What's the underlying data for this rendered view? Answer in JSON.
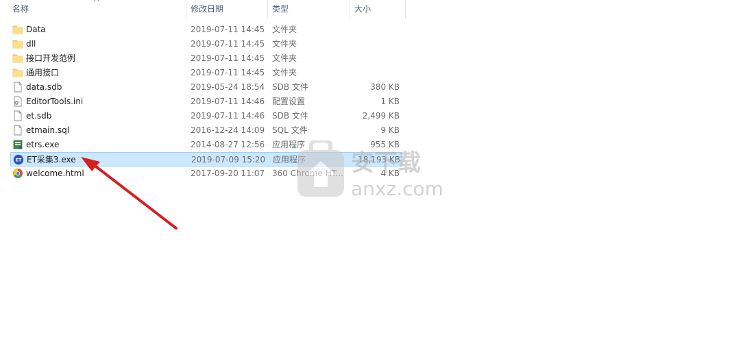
{
  "columns": {
    "name": "名称",
    "date": "修改日期",
    "type": "类型",
    "size": "大小"
  },
  "files": [
    {
      "name": "Data",
      "date": "2019-07-11 14:45",
      "type": "文件夹",
      "size": "",
      "icon": "folder-icon"
    },
    {
      "name": "dll",
      "date": "2019-07-11 14:45",
      "type": "文件夹",
      "size": "",
      "icon": "folder-icon"
    },
    {
      "name": "接口开发范例",
      "date": "2019-07-11 14:45",
      "type": "文件夹",
      "size": "",
      "icon": "folder-icon"
    },
    {
      "name": "通用接口",
      "date": "2019-07-11 14:45",
      "type": "文件夹",
      "size": "",
      "icon": "folder-icon"
    },
    {
      "name": "data.sdb",
      "date": "2019-05-24 18:54",
      "type": "SDB 文件",
      "size": "380 KB",
      "icon": "file-icon"
    },
    {
      "name": "EditorTools.ini",
      "date": "2019-07-11 14:46",
      "type": "配置设置",
      "size": "1 KB",
      "icon": "settings-file-icon"
    },
    {
      "name": "et.sdb",
      "date": "2019-07-11 14:46",
      "type": "SDB 文件",
      "size": "2,499 KB",
      "icon": "file-icon"
    },
    {
      "name": "etmain.sql",
      "date": "2016-12-24 14:09",
      "type": "SQL 文件",
      "size": "9 KB",
      "icon": "file-icon"
    },
    {
      "name": "etrs.exe",
      "date": "2014-08-27 12:56",
      "type": "应用程序",
      "size": "955 KB",
      "icon": "exe-icon"
    },
    {
      "name": "ET采集3.exe",
      "date": "2019-07-09 15:20",
      "type": "应用程序",
      "size": "18,193 KB",
      "icon": "et-app-icon"
    },
    {
      "name": "welcome.html",
      "date": "2017-09-20 11:07",
      "type": "360 Chrome HT...",
      "size": "4 KB",
      "icon": "chrome-html-icon"
    }
  ],
  "selected_index": 9,
  "watermark": {
    "text": "anxz.com",
    "brand": "安下载"
  },
  "colors": {
    "selection_bg": "#cce8ff",
    "selection_border": "#99d1ff",
    "folder": "#f8d775",
    "arrow": "#d42020",
    "header_text": "#4c607a"
  }
}
